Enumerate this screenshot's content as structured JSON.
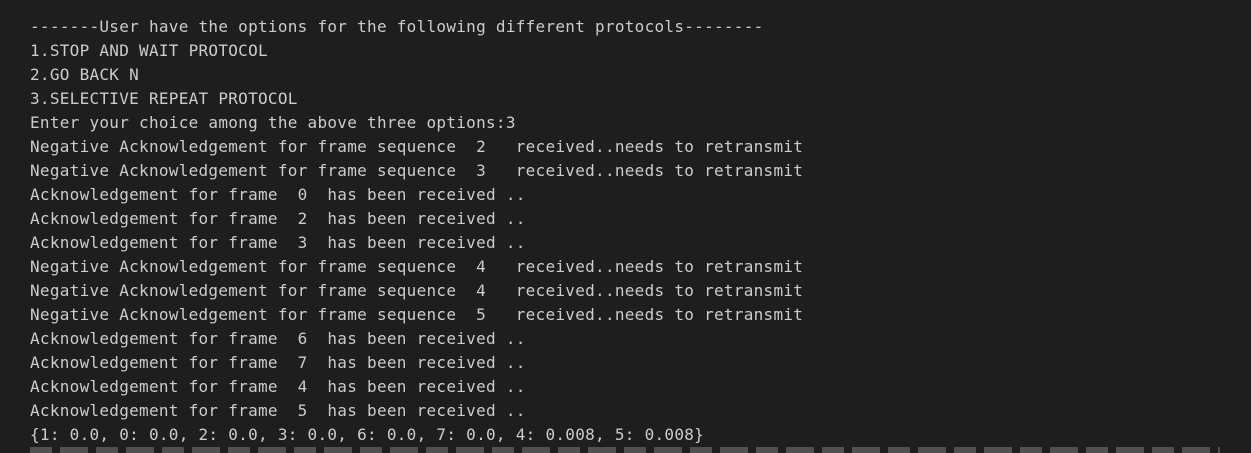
{
  "terminal": {
    "lines": [
      "-------User have the options for the following different protocols--------",
      "1.STOP AND WAIT PROTOCOL",
      "2.GO BACK N",
      "3.SELECTIVE REPEAT PROTOCOL",
      "Enter your choice among the above three options:3",
      "Negative Acknowledgement for frame sequence  2   received..needs to retransmit",
      "Negative Acknowledgement for frame sequence  3   received..needs to retransmit",
      "Acknowledgement for frame  0  has been received ..",
      "Acknowledgement for frame  2  has been received ..",
      "Acknowledgement for frame  3  has been received ..",
      "Negative Acknowledgement for frame sequence  4   received..needs to retransmit",
      "Negative Acknowledgement for frame sequence  4   received..needs to retransmit",
      "Negative Acknowledgement for frame sequence  5   received..needs to retransmit",
      "Acknowledgement for frame  6  has been received ..",
      "Acknowledgement for frame  7  has been received ..",
      "Acknowledgement for frame  4  has been received ..",
      "Acknowledgement for frame  5  has been received ..",
      "{1: 0.0, 0: 0.0, 2: 0.0, 3: 0.0, 6: 0.0, 7: 0.0, 4: 0.008, 5: 0.008}"
    ],
    "text_color": "#cccccc",
    "background_color": "#1e1e1e"
  }
}
